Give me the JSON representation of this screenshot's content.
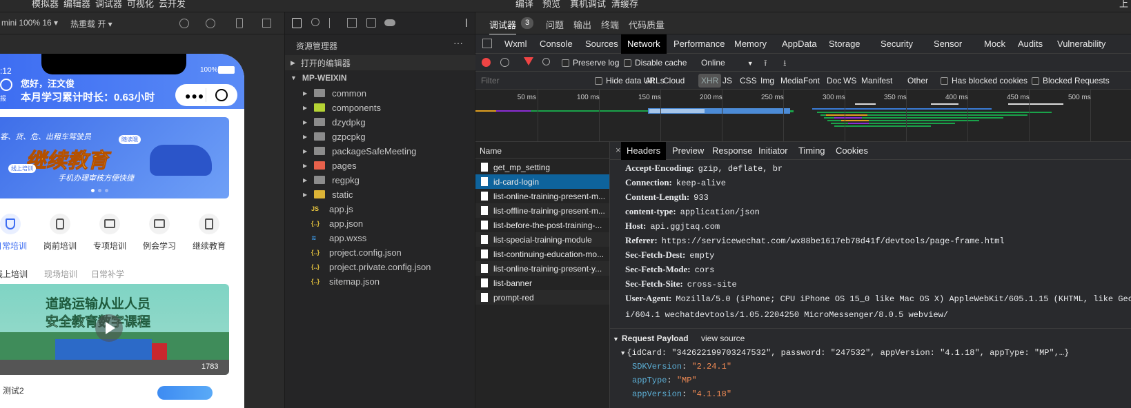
{
  "menubar": {
    "left_items": [
      "模拟器",
      "编辑器",
      "调试器",
      "可视化",
      "云开发"
    ],
    "right_items": [
      "编译",
      "预览",
      "真机调试",
      "清缓存"
    ],
    "far_right": "上"
  },
  "sim_toolbar": {
    "device": "mini 100% 16 ▾",
    "hot_reload": "热重载 开 ▾"
  },
  "phone": {
    "time": ":12",
    "battery": "100%",
    "greeting": "您好，汪文俊",
    "study_time": "本月学习累计时长：0.63小时",
    "badge_label": "报",
    "banner": {
      "top_line": "客、货、危、出租车驾驶员",
      "title": "继续教育",
      "subtitle": "手机办理审核方便快捷",
      "tag_left": "线上培训",
      "tag_right": "随读哦"
    },
    "nav_items": [
      "日常培训",
      "岗前培训",
      "专项培训",
      "例会学习",
      "继续教育"
    ],
    "sub_tabs": [
      "线上培训",
      "现场培训",
      "日常补学"
    ],
    "course": {
      "line1": "道路运输从业人员",
      "line2": "安全教育数字课程",
      "count": "1783"
    },
    "bottom_text": "测试2"
  },
  "explorer": {
    "title": "资源管理器",
    "more": "···",
    "open_editors": "打开的编辑器",
    "project": "MP-WEIXIN",
    "folders": [
      "common",
      "components",
      "dzydpkg",
      "gzpcpkg",
      "packageSafeMeeting",
      "pages",
      "regpkg",
      "static"
    ],
    "files": [
      "app.js",
      "app.json",
      "app.wxss",
      "project.config.json",
      "project.private.config.json",
      "sitemap.json"
    ]
  },
  "devtools": {
    "top_tabs": [
      "调试器",
      "问题",
      "输出",
      "终端",
      "代码质量"
    ],
    "debugger_badge": "3",
    "panel_tabs": [
      "Wxml",
      "Console",
      "Sources",
      "Network",
      "Performance",
      "Memory",
      "AppData",
      "Storage",
      "Security",
      "Sensor",
      "Mock",
      "Audits",
      "Vulnerability"
    ],
    "active_panel": "Network",
    "preserve_log": "Preserve log",
    "disable_cache": "Disable cache",
    "throttle": "Online",
    "filter_placeholder": "Filter",
    "hide_data_urls": "Hide data URLs",
    "type_filters": [
      "All",
      "Cloud",
      "XHR",
      "JS",
      "CSS",
      "Img",
      "Media",
      "Font",
      "Doc",
      "WS",
      "Manifest",
      "Other"
    ],
    "active_filter": "XHR",
    "has_blocked": "Has blocked cookies",
    "blocked_requests": "Blocked Requests",
    "timeline_ticks": [
      "50 ms",
      "100 ms",
      "150 ms",
      "200 ms",
      "250 ms",
      "300 ms",
      "350 ms",
      "400 ms",
      "450 ms",
      "500 ms"
    ],
    "name_header": "Name",
    "requests": [
      "get_mp_setting",
      "id-card-login",
      "list-online-training-present-m...",
      "list-offline-training-present-m...",
      "list-before-the-post-training-...",
      "list-special-training-module",
      "list-continuing-education-mo...",
      "list-online-training-present-y...",
      "list-banner",
      "prompt-red"
    ],
    "selected_request": "id-card-login",
    "detail_tabs": [
      "Headers",
      "Preview",
      "Response",
      "Initiator",
      "Timing",
      "Cookies"
    ],
    "close": "×",
    "headers": [
      {
        "k": "Accept-Encoding:",
        "v": "gzip, deflate, br"
      },
      {
        "k": "Connection:",
        "v": "keep-alive"
      },
      {
        "k": "Content-Length:",
        "v": "933"
      },
      {
        "k": "content-type:",
        "v": "application/json"
      },
      {
        "k": "Host:",
        "v": "api.ggjtaq.com"
      },
      {
        "k": "Referer:",
        "v": "https://servicewechat.com/wx88be1617eb78d41f/devtools/page-frame.html"
      },
      {
        "k": "Sec-Fetch-Dest:",
        "v": "empty"
      },
      {
        "k": "Sec-Fetch-Mode:",
        "v": "cors"
      },
      {
        "k": "Sec-Fetch-Site:",
        "v": "cross-site"
      },
      {
        "k": "User-Agent:",
        "v": "Mozilla/5.0 (iPhone; CPU iPhone OS 15_0 like Mac OS X) AppleWebKit/605.1.15 (KHTML, like Gecko) Ver"
      }
    ],
    "ua_cont": "i/604.1 wechatdevtools/1.05.2204250 MicroMessenger/8.0.5 webview/",
    "payload_title": "Request Payload",
    "view_source": "view source",
    "payload_summary": "{idCard: \"342622199703247532\", password: \"247532\", appVersion: \"4.1.18\", appType: \"MP\",…}",
    "payload_items": [
      {
        "k": "SDKVersion",
        "v": "\"2.24.1\""
      },
      {
        "k": "appType",
        "v": "\"MP\""
      },
      {
        "k": "appVersion",
        "v": "\"4.1.18\""
      }
    ]
  }
}
